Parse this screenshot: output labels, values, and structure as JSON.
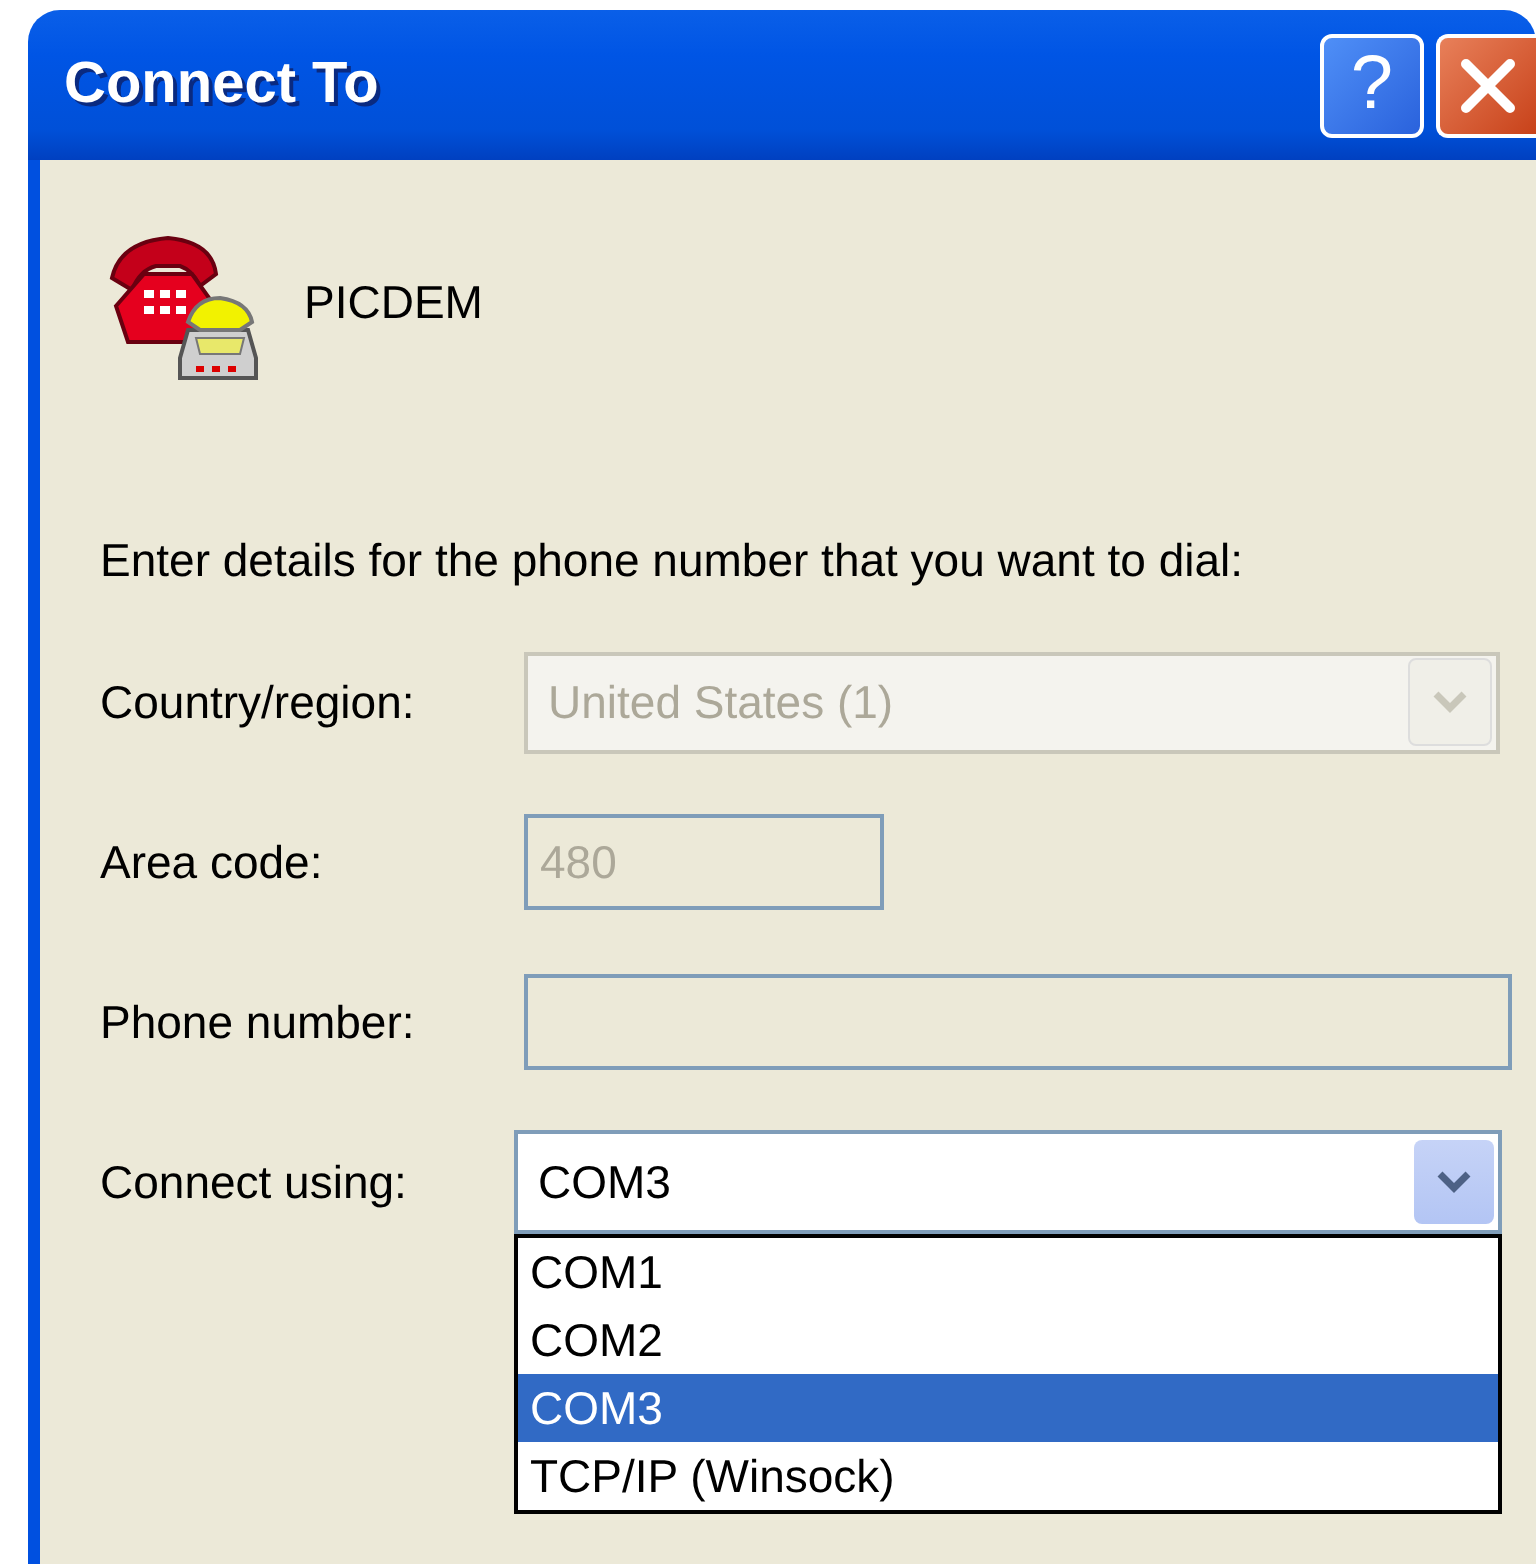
{
  "window": {
    "title": "Connect To",
    "buttons": [
      {
        "kind": "help",
        "label": "?"
      },
      {
        "kind": "close"
      }
    ]
  },
  "connection": {
    "name": "PICDEM"
  },
  "prompt": "Enter details for the phone number that you want to dial:",
  "fields": [
    {
      "kind": "combo",
      "label": "Country/region:",
      "value": "United States (1)",
      "disabled": true,
      "expanded": false
    },
    {
      "kind": "text",
      "label": "Area code:",
      "value": "480",
      "disabled": true
    },
    {
      "kind": "text",
      "label": "Phone number:",
      "disabled": true
    },
    {
      "kind": "combo",
      "label": "Connect using:",
      "value": "COM3",
      "disabled": false,
      "expanded": true,
      "options": [
        {
          "label": "COM1",
          "selected": false
        },
        {
          "label": "COM2",
          "selected": false
        },
        {
          "label": "COM3",
          "selected": true
        },
        {
          "label": "TCP/IP (Winsock)",
          "selected": false
        }
      ]
    }
  ]
}
